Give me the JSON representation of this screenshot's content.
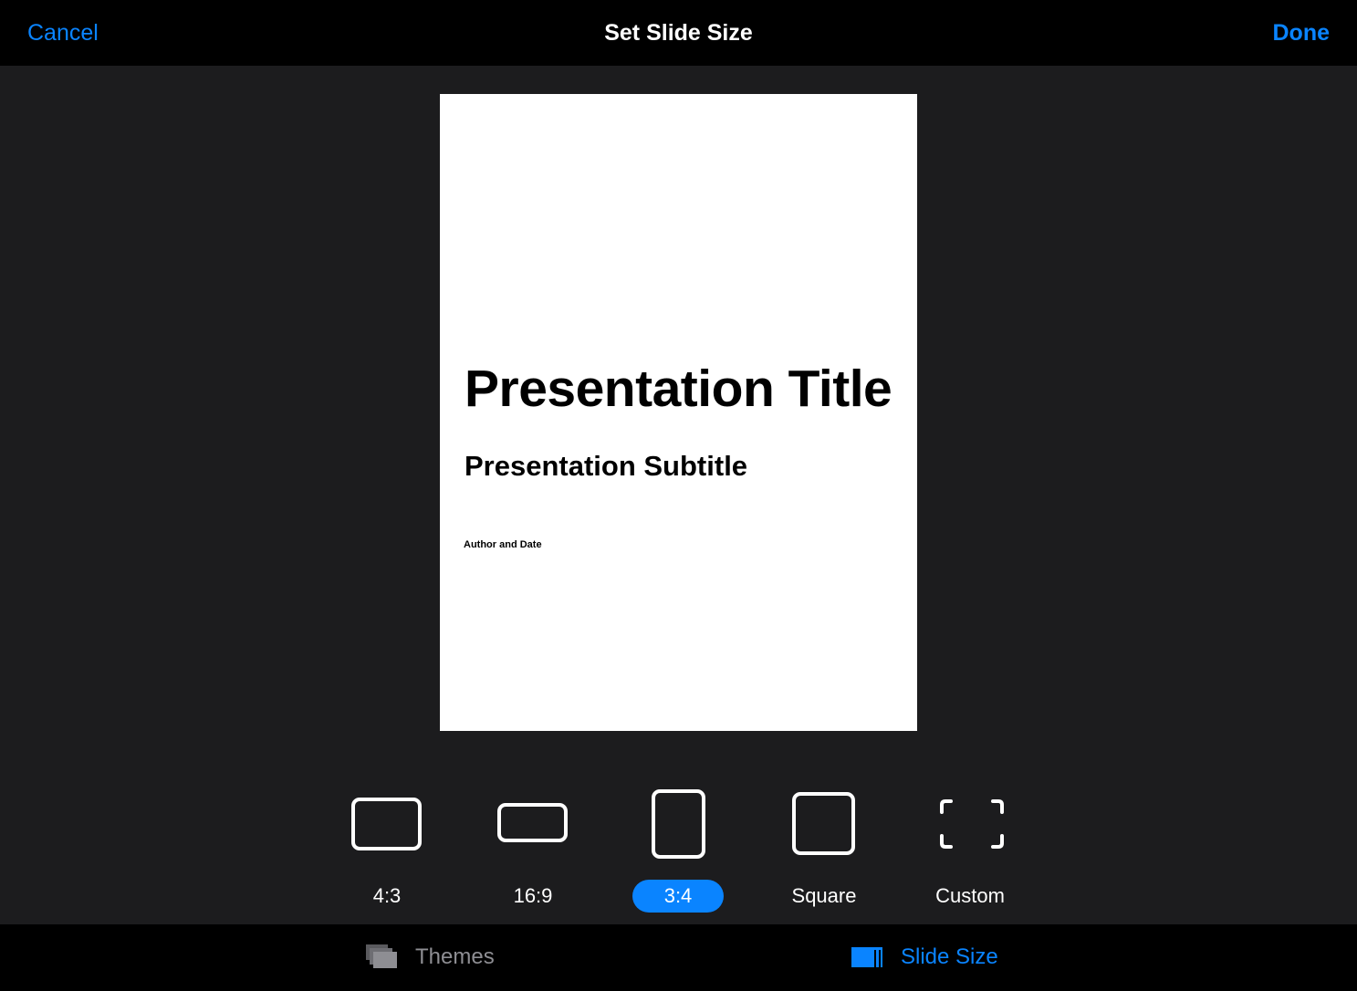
{
  "header": {
    "cancel_label": "Cancel",
    "title": "Set Slide Size",
    "done_label": "Done"
  },
  "slide_preview": {
    "title": "Presentation Title",
    "subtitle": "Presentation Subtitle",
    "author": "Author and Date"
  },
  "size_options": [
    {
      "label": "4:3",
      "icon": "landscape-4-3-icon",
      "selected": false
    },
    {
      "label": "16:9",
      "icon": "widescreen-16-9-icon",
      "selected": false
    },
    {
      "label": "3:4",
      "icon": "portrait-3-4-icon",
      "selected": true
    },
    {
      "label": "Square",
      "icon": "square-icon",
      "selected": false
    },
    {
      "label": "Custom",
      "icon": "custom-size-icon",
      "selected": false
    }
  ],
  "tabs": [
    {
      "label": "Themes",
      "icon": "themes-icon",
      "active": false
    },
    {
      "label": "Slide Size",
      "icon": "slide-size-icon",
      "active": true
    }
  ],
  "colors": {
    "accent": "#0a84ff",
    "background": "#1c1c1e",
    "bar": "#000000",
    "inactive_tab": "#8e8e93"
  }
}
